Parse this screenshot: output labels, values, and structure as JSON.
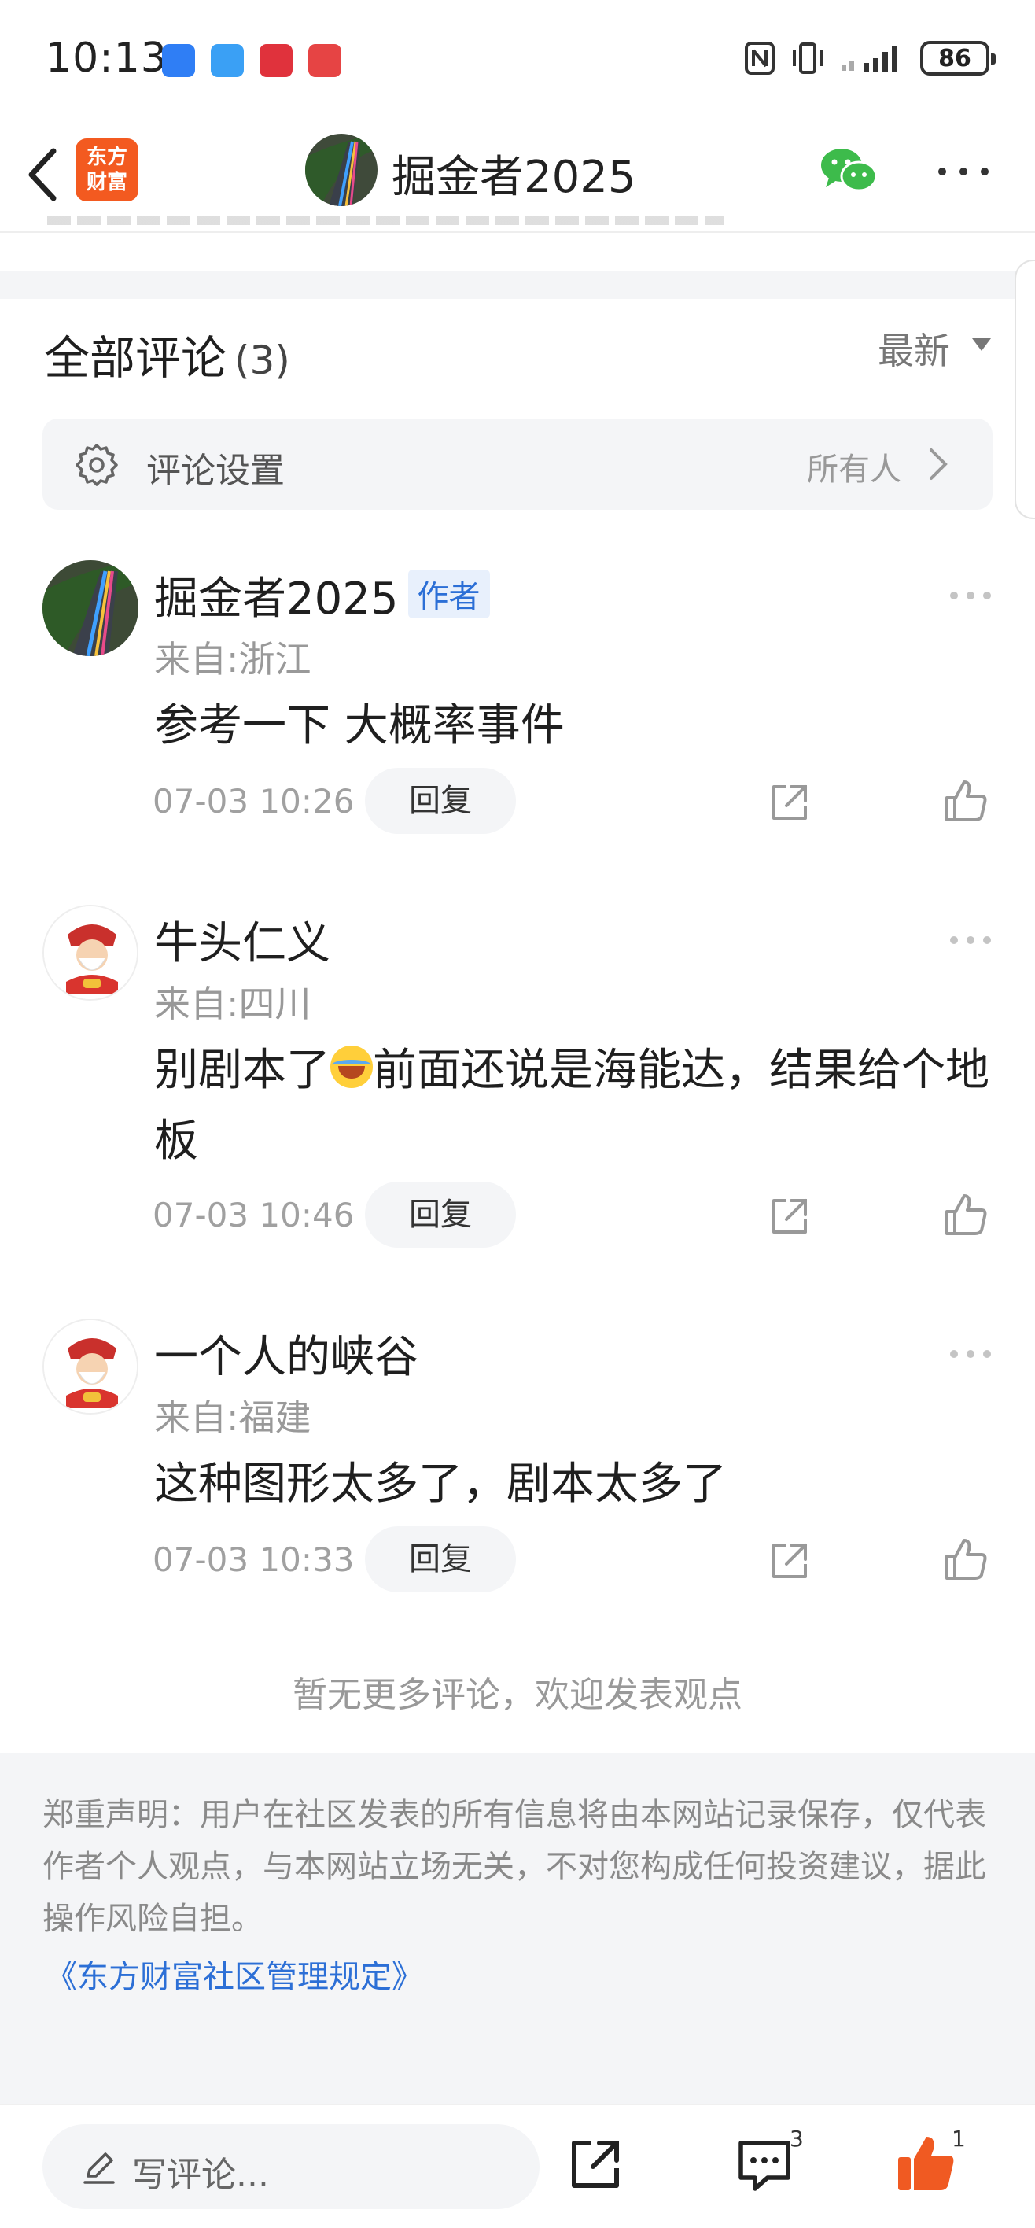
{
  "status_bar": {
    "time": "10:13",
    "battery": "86"
  },
  "header": {
    "logo_line1": "东方",
    "logo_line2": "财富",
    "title": "掘金者2025"
  },
  "comments_section": {
    "title": "全部评论",
    "count": "(3)",
    "sort_label": "最新",
    "settings_label": "评论设置",
    "settings_value": "所有人"
  },
  "comments": [
    {
      "author": "掘金者2025",
      "badge": "作者",
      "location": "来自:浙江",
      "text": "参考一下 大概率事件",
      "time": "07-03 10:26",
      "reply_label": "回复"
    },
    {
      "author": "牛头仁义",
      "location": "来自:四川",
      "text_before_emoji": "别剧本了",
      "emoji": "face-with-tears-of-joy",
      "text_after_emoji": "前面还说是海能达，结果给个地板",
      "time": "07-03 10:46",
      "reply_label": "回复"
    },
    {
      "author": "一个人的峡谷",
      "location": "来自:福建",
      "text": "这种图形太多了，剧本太多了",
      "time": "07-03 10:33",
      "reply_label": "回复"
    }
  ],
  "end_note": "暂无更多评论，欢迎发表观点",
  "disclaimer": {
    "text": "郑重声明：用户在社区发表的所有信息将由本网站记录保存，仅代表作者个人观点，与本网站立场无关，不对您构成任何投资建议，据此操作风险自担。",
    "link": "《东方财富社区管理规定》"
  },
  "bottom_bar": {
    "input_placeholder": "写评论...",
    "comment_count": "3",
    "like_count": "1"
  },
  "colors": {
    "brand_orange": "#f35a20",
    "link_blue": "#2c6fd6",
    "like_orange": "#f05a22",
    "wechat_green": "#3dbb4b"
  }
}
